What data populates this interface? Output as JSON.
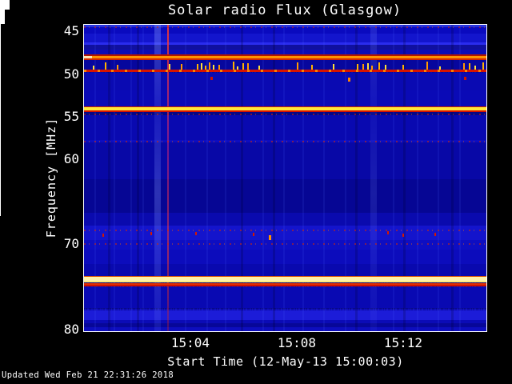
{
  "title": "Solar radio Flux (Glasgow)",
  "footer": {
    "updated": "Updated Wed Feb 21 22:31:26 2018"
  },
  "x_axis": {
    "label": "Start Time (12-May-13 15:00:03)",
    "start_time": "15:00:03",
    "major_ticks": [
      {
        "label": "15:04",
        "minute": 4
      },
      {
        "label": "15:08",
        "minute": 8
      },
      {
        "label": "15:12",
        "minute": 12
      }
    ],
    "minor_tick_minutes": [
      1,
      2,
      3,
      5,
      6,
      7,
      9,
      10,
      11,
      13,
      14,
      15
    ],
    "range_minutes": [
      0,
      15.13
    ]
  },
  "y_axis": {
    "label": "Frequency [MHz]",
    "major_ticks": [
      {
        "label": "45",
        "mhz": 45
      },
      {
        "label": "50",
        "mhz": 50
      },
      {
        "label": "55",
        "mhz": 55
      },
      {
        "label": "60",
        "mhz": 60
      },
      {
        "label": "70",
        "mhz": 70
      },
      {
        "label": "80",
        "mhz": 80
      }
    ],
    "minor_tick_mhz": [
      47.5,
      52.5,
      57.5,
      62.5,
      65,
      67.5,
      72.5,
      75,
      77.5
    ],
    "range_mhz": [
      44.3,
      80.3
    ],
    "inverted": true
  },
  "colors": {
    "background": "#000000",
    "text": "#ffffff",
    "frame": "#ffffff",
    "base_blue": "#0a0ab8",
    "bright_blue": "#2a2cee",
    "band_orange": "#ff9100",
    "band_yellow": "#ffe838",
    "band_pale_yellow": "#fff3a8",
    "line_red": "#d81400",
    "burst_yellow": "#ffd22a",
    "streak_blue": "#7d9cff"
  },
  "chart_data": {
    "type": "heatmap",
    "title": "Solar radio Flux (Glasgow)",
    "xlabel": "Start Time (12-May-13 15:00:03)",
    "ylabel": "Frequency [MHz]",
    "x_tick_labels": [
      "15:04",
      "15:08",
      "15:12"
    ],
    "y_tick_labels": [
      45,
      50,
      55,
      60,
      70,
      80
    ],
    "x_range_minutes_after_start": [
      0,
      15.13
    ],
    "y_range_mhz": [
      44.3,
      80.3
    ],
    "y_axis_inverted": true,
    "legend_position": "none",
    "grid": false,
    "colormap": "dark-blue background = low flux; bright blue = enhanced flux; yellow/orange/red = strong narrowband signal/interference",
    "horizontal_bands": [
      {
        "id": "band-46-bright-blue",
        "freq_mhz": 46.5,
        "appearance": "thin bright blue line, full duration"
      },
      {
        "id": "band-48-orange",
        "freq_mhz": 48.15,
        "appearance": "orange band with red edges, full duration"
      },
      {
        "id": "line-49-7-red",
        "freq_mhz": 49.7,
        "appearance": "narrow red line with orange flecks, full duration"
      },
      {
        "id": "band-54-yellow",
        "freq_mhz": 54.25,
        "appearance": "bright yellow band with red edges, full duration"
      },
      {
        "id": "band-69-bright-blue",
        "freq_mhz": 68.8,
        "appearance": "enhanced mottled blue band with sporadic red/orange dots"
      },
      {
        "id": "band-74-yellow-white",
        "freq_mhz": 74.2,
        "appearance": "brightest pale-yellow band, full duration"
      },
      {
        "id": "line-74-8-red",
        "freq_mhz": 74.8,
        "appearance": "red line just below the 74.2 MHz band"
      },
      {
        "id": "band-78-bright-blue",
        "freq_mhz": 78.4,
        "appearance": "enhanced blue band, full duration"
      }
    ],
    "rfi_bursts_49mhz": {
      "freq_range_mhz": [
        48.6,
        49.6
      ],
      "minutes_after_start": [
        0.33,
        0.78,
        1.23,
        3.19,
        3.64,
        4.24,
        4.39,
        4.54,
        4.69,
        4.84,
        5.05,
        5.59,
        5.74,
        5.95,
        6.14,
        6.56,
        8.0,
        8.54,
        9.35,
        10.26,
        10.47,
        10.65,
        10.8,
        11.07,
        11.31,
        11.97,
        12.87,
        13.35,
        14.26,
        14.47,
        14.68,
        14.98
      ]
    },
    "sporadic_dots_69mhz": [
      {
        "minute": 0.69,
        "mhz": 69.0
      },
      {
        "minute": 2.5,
        "mhz": 68.8
      },
      {
        "minute": 4.18,
        "mhz": 68.8
      },
      {
        "minute": 6.35,
        "mhz": 68.9
      },
      {
        "minute": 6.95,
        "mhz": 69.3,
        "strong": true
      },
      {
        "minute": 11.4,
        "mhz": 68.7
      },
      {
        "minute": 11.97,
        "mhz": 69.0
      },
      {
        "minute": 13.17,
        "mhz": 68.9
      }
    ],
    "isolated_dots": [
      {
        "minute": 4.75,
        "mhz": 50.4
      },
      {
        "minute": 9.92,
        "mhz": 50.5,
        "strong": true
      },
      {
        "minute": 14.29,
        "mhz": 50.4
      }
    ],
    "vertical_events": [
      {
        "minute": 2.78,
        "appearance": "light blue broadband streak"
      },
      {
        "minute": 3.12,
        "appearance": "thin red broadband line"
      },
      {
        "minute": 10.9,
        "appearance": "faint light blue broadband streak"
      }
    ]
  }
}
